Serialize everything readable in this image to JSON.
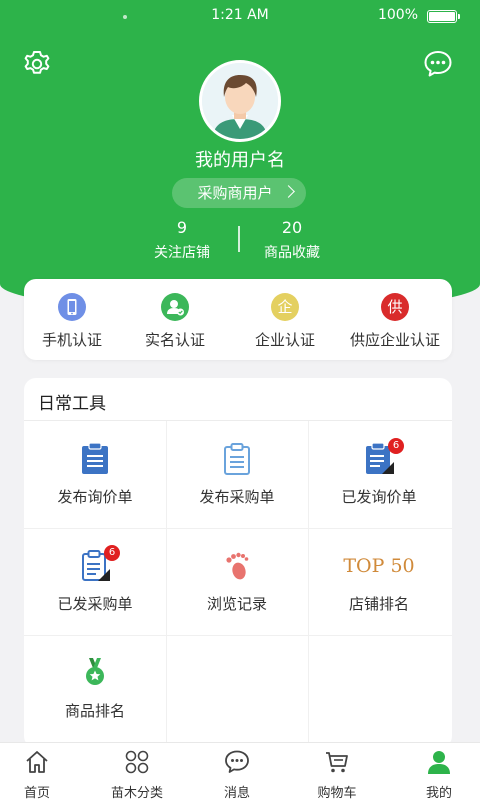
{
  "status_bar": {
    "time": "1:21 AM",
    "battery": "100%"
  },
  "header": {
    "username": "我的用户名",
    "role": "采购商用户",
    "stats": [
      {
        "value": "9",
        "label": "关注店铺"
      },
      {
        "value": "20",
        "label": "商品收藏"
      }
    ]
  },
  "icons": {
    "settings": "gear-icon",
    "messages": "chat-bubble-icon"
  },
  "verification": [
    {
      "label": "手机认证",
      "icon": "phone-icon",
      "color": "#6f8fe6"
    },
    {
      "label": "实名认证",
      "icon": "person-check-icon",
      "color": "#3cb75a"
    },
    {
      "label": "企业认证",
      "icon": "enterprise-icon",
      "glyph": "企",
      "color": "#e4d060"
    },
    {
      "label": "供应企业认证",
      "icon": "supplier-icon",
      "glyph": "供",
      "color": "#d92b2b"
    }
  ],
  "tools": {
    "title": "日常工具",
    "items": [
      {
        "label": "发布询价单",
        "icon": "clipboard-list-icon"
      },
      {
        "label": "发布采购单",
        "icon": "clipboard-outline-icon"
      },
      {
        "label": "已发询价单",
        "icon": "inquiry-sent-icon",
        "badge": "6"
      },
      {
        "label": "已发采购单",
        "icon": "purchase-sent-icon",
        "badge": "6"
      },
      {
        "label": "浏览记录",
        "icon": "footprint-icon"
      },
      {
        "label": "店铺排名",
        "icon": "top50-icon",
        "text": "TOP 50"
      },
      {
        "label": "商品排名",
        "icon": "medal-icon"
      }
    ]
  },
  "tabbar": [
    {
      "label": "首页",
      "icon": "home-icon",
      "active": false
    },
    {
      "label": "苗木分类",
      "icon": "category-grid-icon",
      "active": false
    },
    {
      "label": "消息",
      "icon": "message-icon",
      "active": false
    },
    {
      "label": "购物车",
      "icon": "cart-icon",
      "active": false
    },
    {
      "label": "我的",
      "icon": "profile-icon",
      "active": true
    }
  ],
  "colors": {
    "brand_green": "#2db34a",
    "badge_red": "#e02020",
    "top50_gold": "#d08a3a"
  }
}
